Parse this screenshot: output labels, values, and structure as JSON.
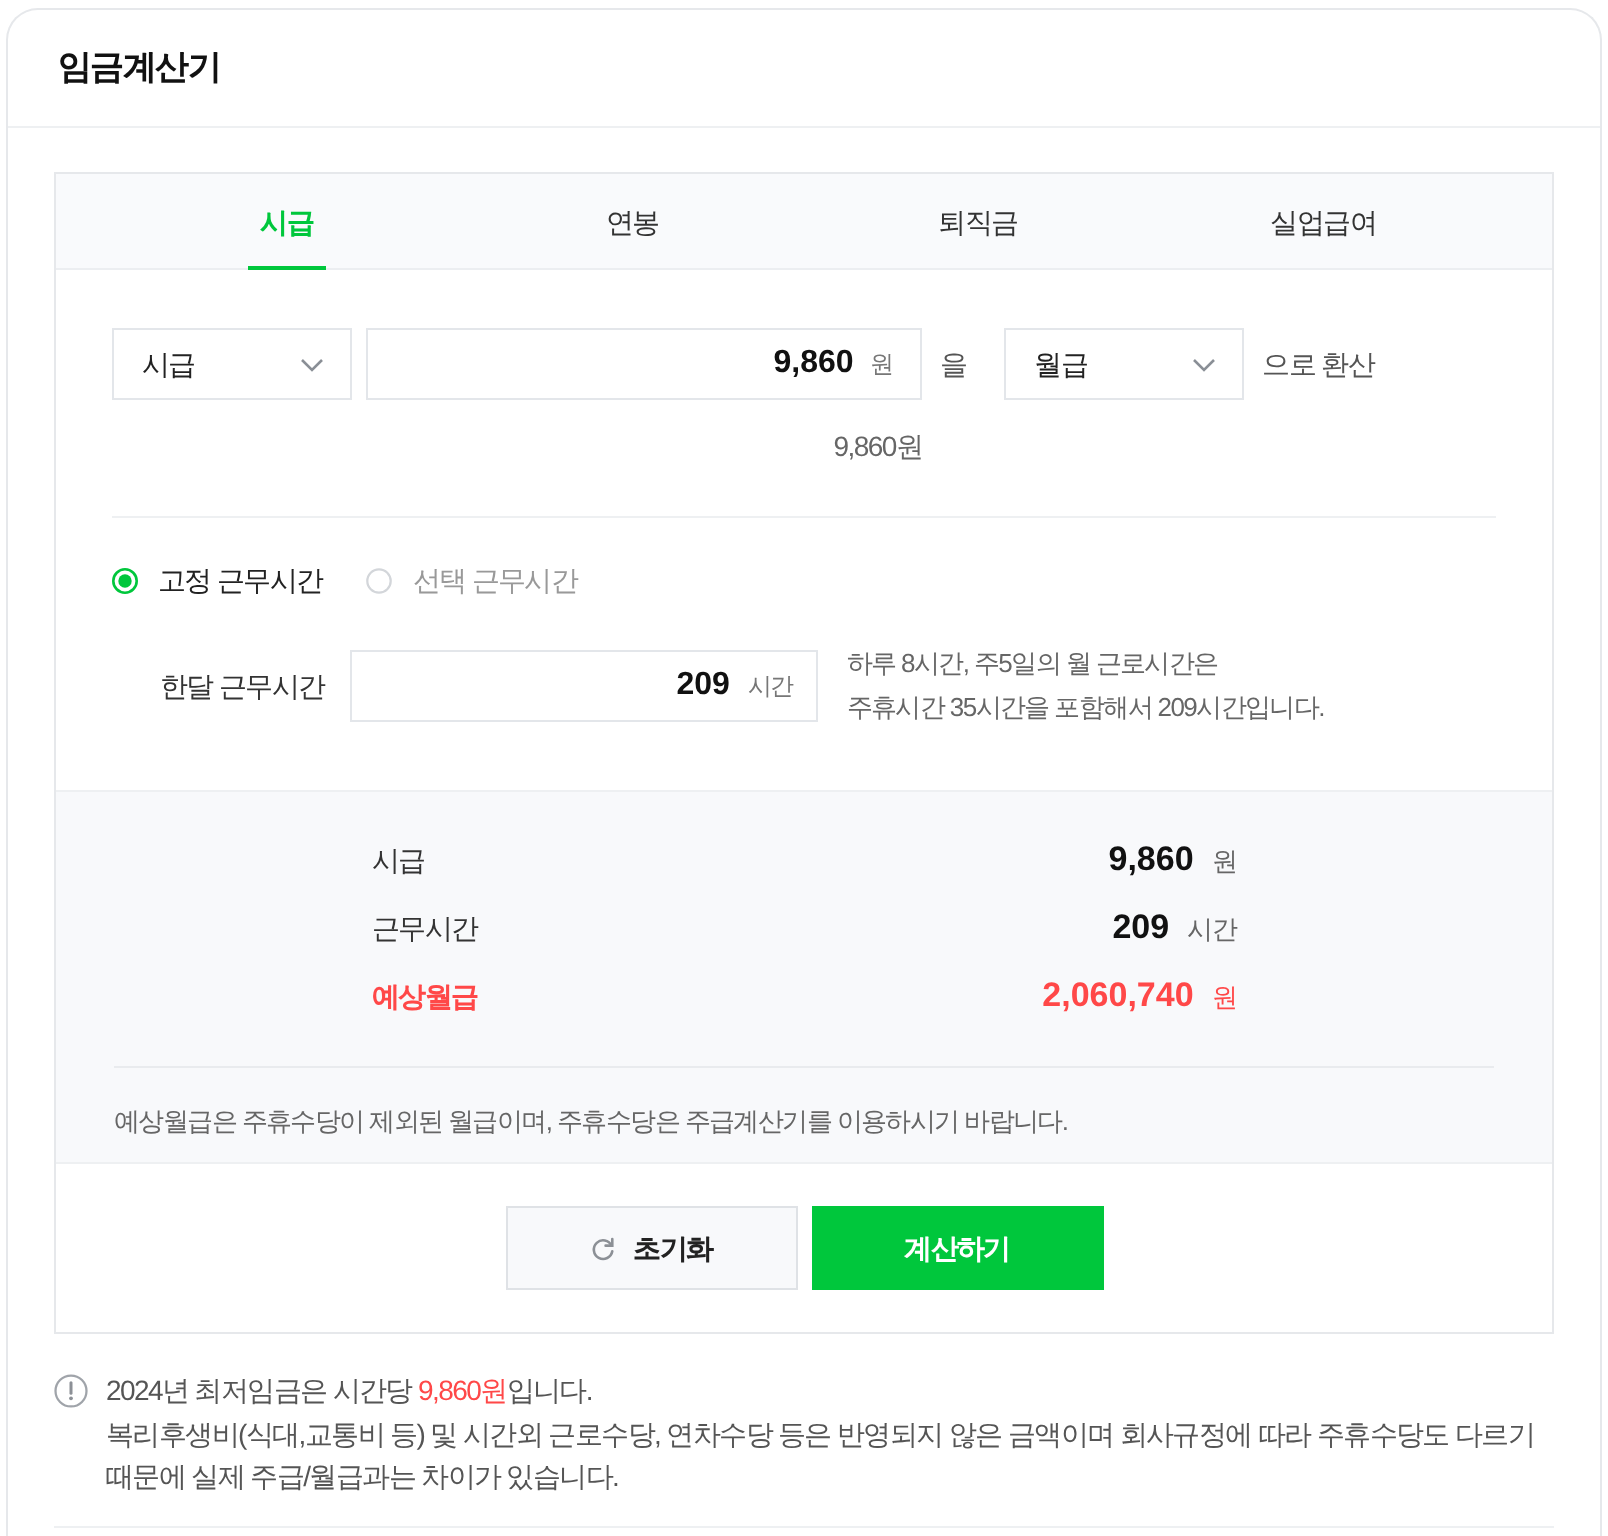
{
  "header": {
    "title": "임금계산기"
  },
  "tabs": [
    {
      "label": "시급",
      "selected": true
    },
    {
      "label": "연봉",
      "selected": false
    },
    {
      "label": "퇴직금",
      "selected": false
    },
    {
      "label": "실업급여",
      "selected": false
    }
  ],
  "converter": {
    "from_select": "시급",
    "amount": {
      "value": "9,860",
      "unit": "원"
    },
    "particle": "을",
    "to_select": "월급",
    "suffix": "으로 환산",
    "readout": "9,860원"
  },
  "work_hours": {
    "options": [
      {
        "label": "고정 근무시간",
        "selected": true
      },
      {
        "label": "선택 근무시간",
        "selected": false
      }
    ],
    "monthly": {
      "label": "한달 근무시간",
      "value": "209",
      "unit": "시간"
    },
    "description": [
      "하루 8시간, 주5일의 월 근로시간은",
      "주휴시간 35시간을 포함해서 209시간입니다."
    ]
  },
  "summary": {
    "rows": [
      {
        "label": "시급",
        "value": "9,860",
        "unit": "원",
        "highlight": false
      },
      {
        "label": "근무시간",
        "value": "209",
        "unit": "시간",
        "highlight": false
      },
      {
        "label": "예상월급",
        "value": "2,060,740",
        "unit": "원",
        "highlight": true
      }
    ],
    "note": "예상월급은 주휴수당이 제외된 월급이며, 주휴수당은 주급계산기를 이용하시기 바랍니다."
  },
  "buttons": [
    {
      "kind": "reset",
      "label": "초기화"
    },
    {
      "kind": "primary",
      "label": "계산하기"
    }
  ],
  "notice": {
    "minimum_wage": [
      {
        "text": "2024년 최저임금은 시간당 ",
        "highlight": false
      },
      {
        "text": "9,860원",
        "highlight": true
      },
      {
        "text": "입니다.",
        "highlight": false
      }
    ],
    "disclaimer": [
      "복리후생비(식대,교통비 등) 및 시간외 근로수당, 연차수당 등은 반영되지 않은 금액이며 회사규정에 따라 주휴수당도 다르기",
      "때문에 실제 주급/월급과는 차이가 있습니다."
    ]
  }
}
